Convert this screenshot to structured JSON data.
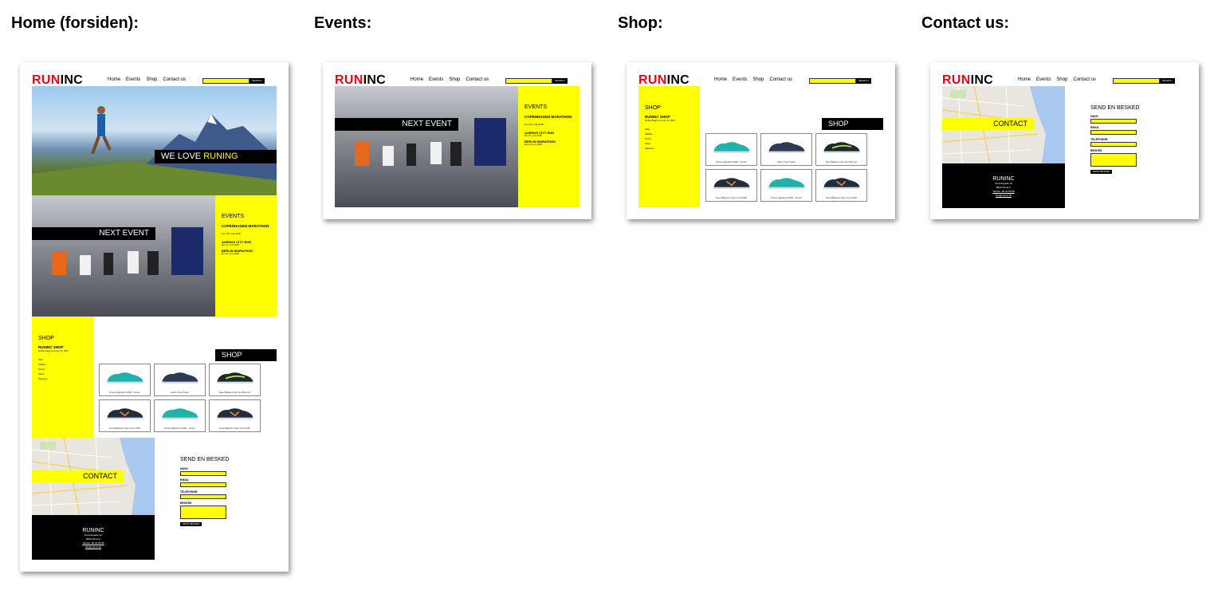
{
  "headings": {
    "home": "Home (forsiden):",
    "events": "Events:",
    "shop": "Shop:",
    "contact": "Contact us:"
  },
  "logo": {
    "run": "RUN",
    "inc": "INC"
  },
  "nav": {
    "home": "Home",
    "events": "Events",
    "shop": "Shop",
    "contact": "Contact us"
  },
  "search": {
    "button": "SEARCH"
  },
  "hero": {
    "text1": "WE LOVE ",
    "text2": "RUNING"
  },
  "events": {
    "banner": "NEXT EVENT",
    "title": "EVENTS",
    "items": [
      {
        "name": "COPENHAGEN MARATHON",
        "date": "Den 25. maj 2018"
      },
      {
        "name": "AARHUS CITY RUN",
        "date": "Den 6. juni 2018"
      },
      {
        "name": "BERLIN MARATHON",
        "date": "Den 6. juni 2018"
      }
    ]
  },
  "shop": {
    "title": "SHOP",
    "banner": "SHOP",
    "subtitle": "RUNINC SHOP",
    "tagline": "Gratis fragt ved over kr. 500,-",
    "brands": [
      "Nike",
      "Adidas",
      "Puma",
      "Asics",
      "Saucony"
    ],
    "products": [
      {
        "name": "Puma Highland 3000 - brown",
        "color": "#20b2aa"
      },
      {
        "name": "Asics Free Street",
        "color": "#2b3a55"
      },
      {
        "name": "New Balance Runner Bounce",
        "color": "#1d2a2a"
      },
      {
        "name": "New Balance New York 2018",
        "color": "#1f2d3d"
      },
      {
        "name": "Puma Highland 3000 - brown",
        "color": "#20b2aa"
      },
      {
        "name": "New Balance New York 2018",
        "color": "#1f2d3d"
      }
    ]
  },
  "contact": {
    "banner": "CONTACT",
    "form_title": "SEND EN BESKED",
    "labels": {
      "name": "NAVN",
      "email": "EMAIL",
      "phone": "TELEFONNR.",
      "message": "BESKED"
    },
    "send": "SEND BESKED",
    "footer": {
      "brand": "RUNINC",
      "line1": "Kannikegade 12",
      "line2": "8000 Århus C",
      "line3": "Telefon: 96 33 68 98",
      "line4": "info@runinc.dk"
    }
  },
  "colors": {
    "accent": "#ffff00",
    "brand_red": "#e30613",
    "dark": "#000000"
  }
}
